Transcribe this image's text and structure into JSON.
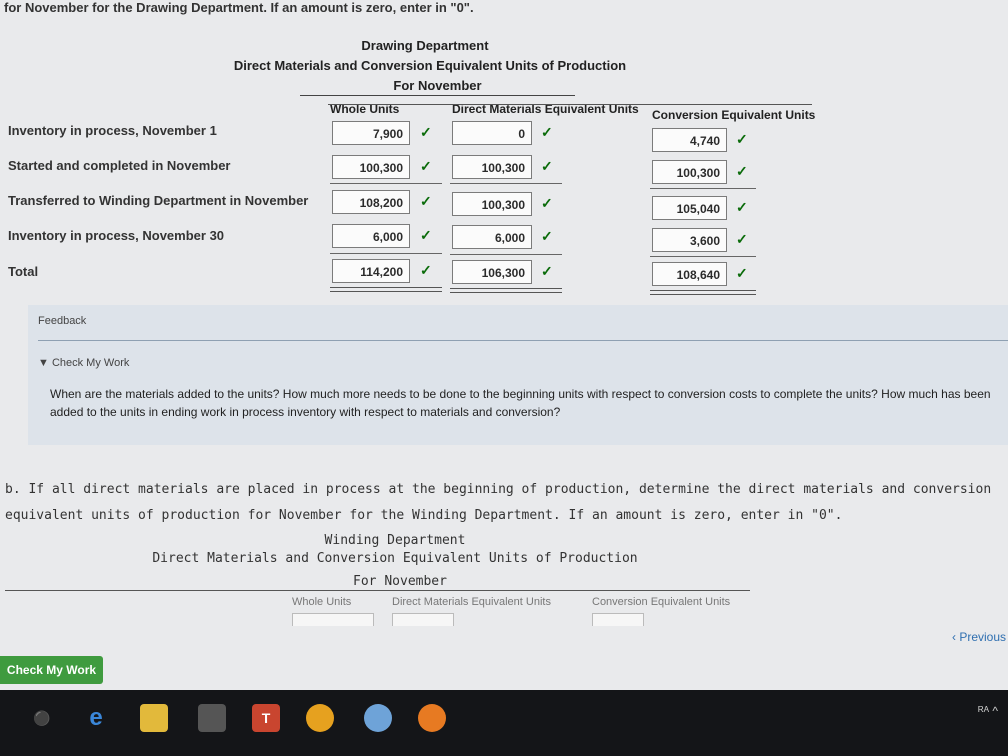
{
  "top_instruction": "for November for the Drawing Department. If an amount is zero, enter in \"0\".",
  "drawing": {
    "title": "Drawing Department",
    "subtitle": "Direct Materials and Conversion Equivalent Units of Production",
    "period": "For November",
    "columns": [
      "Whole Units",
      "Direct Materials Equivalent Units",
      "Conversion Equivalent Units"
    ],
    "rows": [
      {
        "label": "Inventory in process, November 1",
        "whole": "7,900",
        "dm": "0",
        "conv": "4,740"
      },
      {
        "label": "Started and completed in November",
        "whole": "100,300",
        "dm": "100,300",
        "conv": "100,300"
      },
      {
        "label": "Transferred to Winding Department in November",
        "whole": "108,200",
        "dm": "100,300",
        "conv": "105,040"
      },
      {
        "label": "Inventory in process, November 30",
        "whole": "6,000",
        "dm": "6,000",
        "conv": "3,600"
      },
      {
        "label": "Total",
        "whole": "114,200",
        "dm": "106,300",
        "conv": "108,640"
      }
    ],
    "check_mark": "✓"
  },
  "feedback": {
    "title": "Feedback",
    "check_my_work": "▼ Check My Work",
    "text": "When are the materials added to the units? How much more needs to be done to the beginning units with respect to conversion costs to complete the units? How much has been added to the units in ending work in process inventory with respect to materials and conversion?"
  },
  "part_b": {
    "text": "b. If all direct materials are placed in process at the beginning of production, determine the direct materials and conversion equivalent units of production for November for the Winding Department. If an amount is zero, enter in \"0\".",
    "title": "Winding Department",
    "subtitle": "Direct Materials and Conversion Equivalent Units of Production",
    "period": "For November",
    "columns": [
      "Whole Units",
      "Direct Materials Equivalent Units",
      "Conversion Equivalent Units"
    ]
  },
  "buttons": {
    "previous": "‹ Previous",
    "check_my_work": "Check My Work"
  },
  "taskbar": {
    "tray_text": "ᴿᴬ ^"
  }
}
